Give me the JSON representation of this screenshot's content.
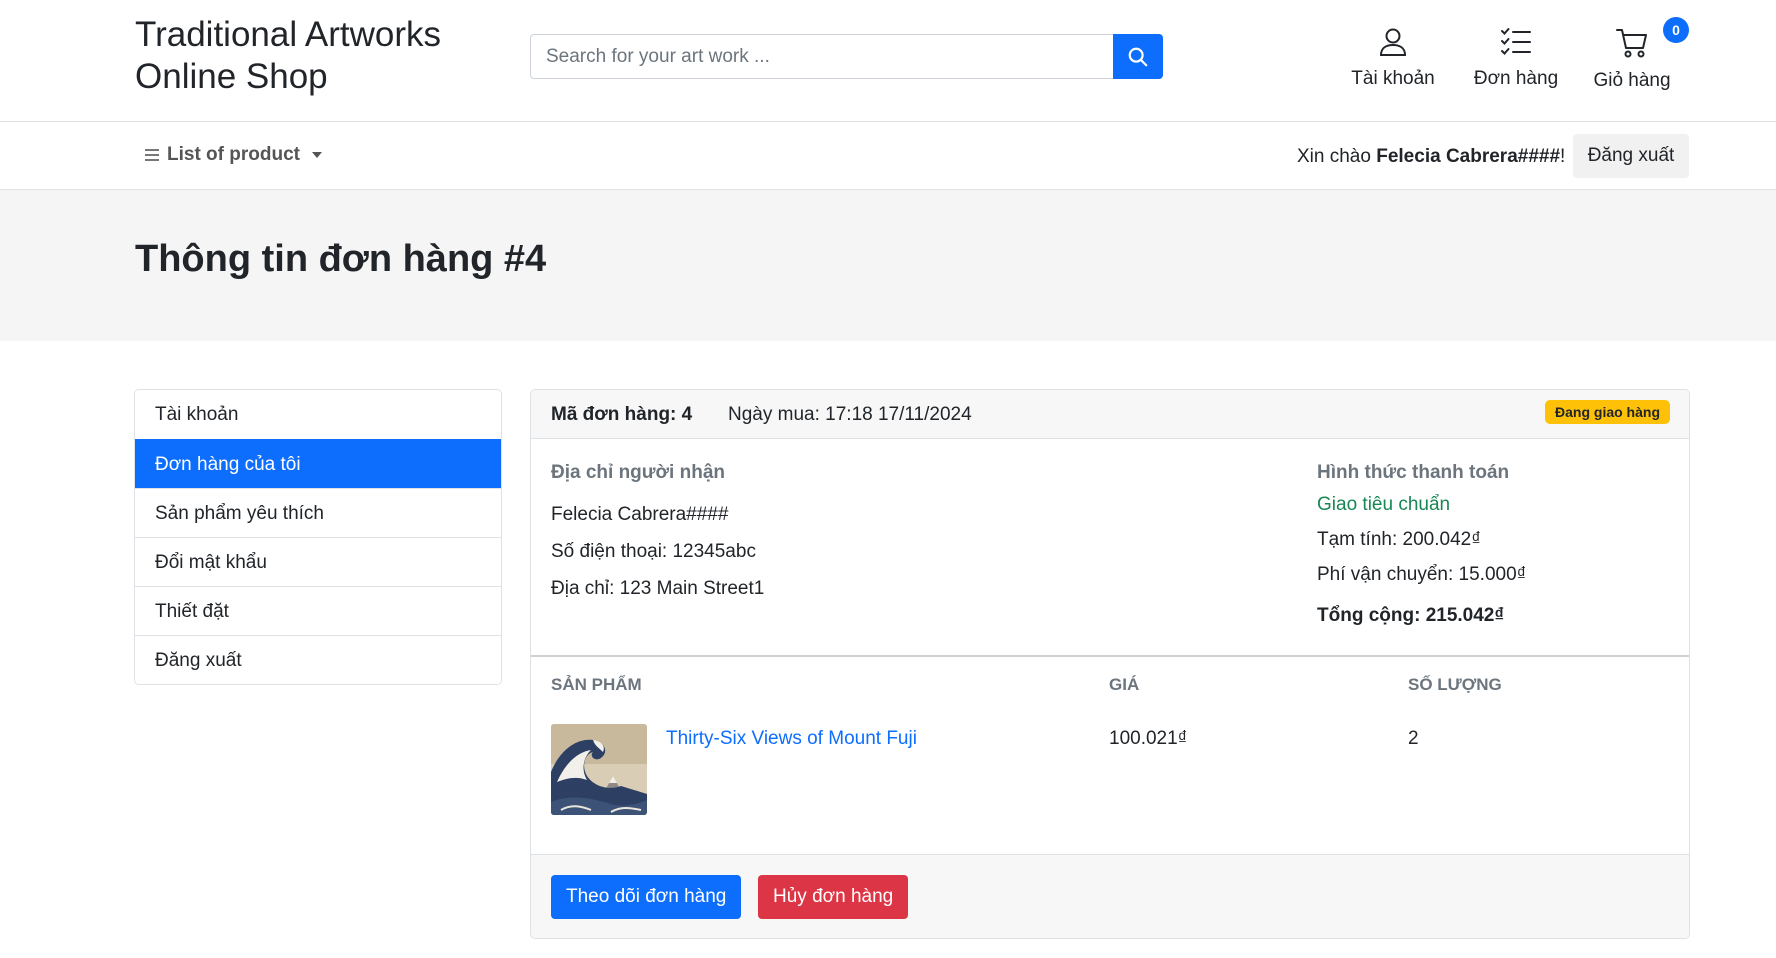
{
  "header": {
    "brand_line1": "Traditional Artworks",
    "brand_line2": "Online Shop",
    "search_placeholder": "Search for your art work ...",
    "account_label": "Tài khoản",
    "orders_label": "Đơn hàng",
    "cart_label": "Giỏ hàng",
    "cart_count": "0"
  },
  "subnav": {
    "category_menu": "List of product",
    "greeting_prefix": "Xin chào ",
    "user_name": "Felecia Cabrera####",
    "greeting_suffix": "!",
    "logout": "Đăng xuất"
  },
  "page": {
    "title": "Thông tin đơn hàng #4"
  },
  "sidebar": {
    "items": [
      {
        "label": "Tài khoản"
      },
      {
        "label": "Đơn hàng của tôi"
      },
      {
        "label": "Sản phẩm yêu thích"
      },
      {
        "label": "Đổi mật khẩu"
      },
      {
        "label": "Thiết đặt"
      },
      {
        "label": "Đăng xuất"
      }
    ]
  },
  "order": {
    "id_label": "Mã đơn hàng: 4",
    "date_label": "Ngày mua: 17:18 17/11/2024",
    "status": "Đang giao hàng",
    "recipient": {
      "heading": "Địa chỉ người nhận",
      "name": "Felecia Cabrera####",
      "phone": "Số điện thoại: 12345abc",
      "address": "Địa chỉ: 123 Main Street1"
    },
    "payment": {
      "heading": "Hình thức thanh toán",
      "method": "Giao tiêu chuẩn",
      "subtotal": "Tạm tính: 200.042₫",
      "shipping": "Phí vận chuyển: 15.000₫",
      "total": "Tổng cộng: 215.042₫"
    },
    "table": {
      "headers": {
        "product": "SẢN PHẨM",
        "price": "GIÁ",
        "quantity": "SỐ LƯỢNG"
      },
      "rows": [
        {
          "name": "Thirty-Six Views of Mount Fuji",
          "price": "100.021₫",
          "quantity": "2"
        }
      ]
    },
    "actions": {
      "track": "Theo dõi đơn hàng",
      "cancel": "Hủy đơn hàng"
    }
  },
  "colors": {
    "primary": "#0d6efd",
    "danger": "#dc3545",
    "warning": "#ffc107",
    "success": "#198754"
  }
}
